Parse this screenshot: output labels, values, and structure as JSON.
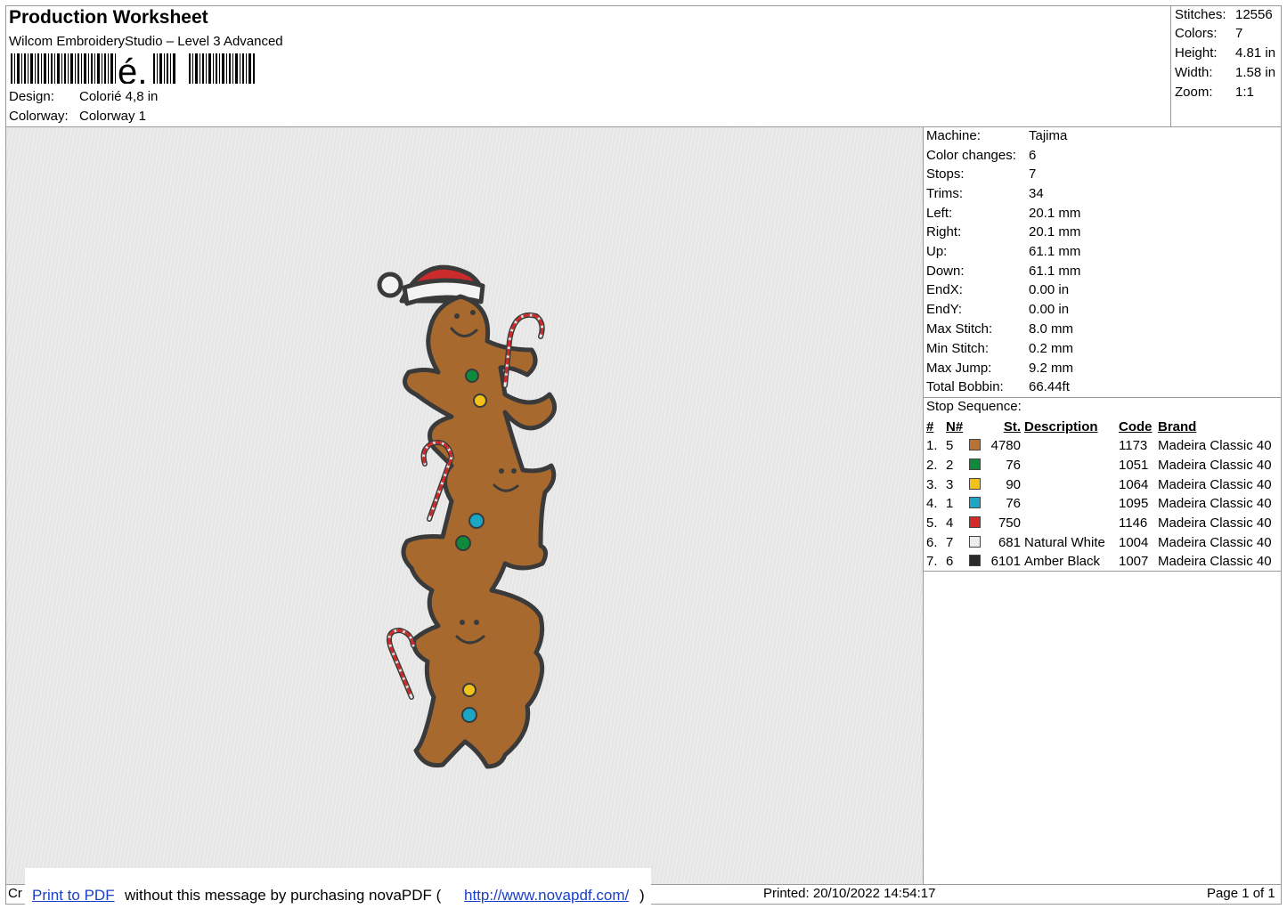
{
  "header": {
    "title": "Production Worksheet",
    "subtitle": "Wilcom EmbroideryStudio – Level 3 Advanced",
    "barcode_text": "é,",
    "design_label": "Design:",
    "design_value": "Colorié 4,8 in",
    "colorway_label": "Colorway:",
    "colorway_value": "Colorway 1"
  },
  "stats": [
    {
      "label": "Stitches:",
      "value": "12556"
    },
    {
      "label": "Colors:",
      "value": "7"
    },
    {
      "label": "Height:",
      "value": "4.81 in"
    },
    {
      "label": "Width:",
      "value": "1.58 in"
    },
    {
      "label": "Zoom:",
      "value": "1:1"
    }
  ],
  "machine_info": [
    {
      "label": "Machine:",
      "value": "Tajima"
    },
    {
      "label": "Color changes:",
      "value": "6"
    },
    {
      "label": "Stops:",
      "value": "7"
    },
    {
      "label": "Trims:",
      "value": "34"
    },
    {
      "label": "Left:",
      "value": "20.1 mm"
    },
    {
      "label": "Right:",
      "value": "20.1 mm"
    },
    {
      "label": "Up:",
      "value": "61.1 mm"
    },
    {
      "label": "Down:",
      "value": "61.1 mm"
    },
    {
      "label": "EndX:",
      "value": "0.00 in"
    },
    {
      "label": "EndY:",
      "value": "0.00 in"
    },
    {
      "label": "Max Stitch:",
      "value": "8.0 mm"
    },
    {
      "label": "Min Stitch:",
      "value": "0.2 mm"
    },
    {
      "label": "Max Jump:",
      "value": "9.2 mm"
    },
    {
      "label": "Total Bobbin:",
      "value": "66.44ft"
    }
  ],
  "stop_sequence": {
    "title": "Stop Sequence:",
    "headers": [
      "#",
      "N#",
      "St.",
      "Description",
      "Code",
      "Brand"
    ],
    "rows": [
      {
        "idx": "1.",
        "n": "5",
        "color": "#b87333",
        "st": "4780",
        "desc": "",
        "code": "1173",
        "brand": "Madeira Classic 40"
      },
      {
        "idx": "2.",
        "n": "2",
        "color": "#0f8a3c",
        "st": "76",
        "desc": "",
        "code": "1051",
        "brand": "Madeira Classic 40"
      },
      {
        "idx": "3.",
        "n": "3",
        "color": "#f2c21a",
        "st": "90",
        "desc": "",
        "code": "1064",
        "brand": "Madeira Classic 40"
      },
      {
        "idx": "4.",
        "n": "1",
        "color": "#1aa6c4",
        "st": "76",
        "desc": "",
        "code": "1095",
        "brand": "Madeira Classic 40"
      },
      {
        "idx": "5.",
        "n": "4",
        "color": "#d42a2a",
        "st": "750",
        "desc": "",
        "code": "1146",
        "brand": "Madeira Classic 40"
      },
      {
        "idx": "6.",
        "n": "7",
        "color": "#ececec",
        "st": "681",
        "desc": "Natural White",
        "code": "1004",
        "brand": "Madeira Classic 40"
      },
      {
        "idx": "7.",
        "n": "6",
        "color": "#2a2a2a",
        "st": "6101",
        "desc": "Amber Black",
        "code": "1007",
        "brand": "Madeira Classic 40"
      }
    ]
  },
  "footer": {
    "left_stub": "Cr",
    "banner_link1": "Print to PDF",
    "banner_mid": " without this message by purchasing novaPDF (",
    "banner_link2": "http://www.novapdf.com/",
    "banner_end": ")",
    "printed": "Printed: 20/10/2022 14:54:17",
    "page": "Page 1 of 1"
  }
}
